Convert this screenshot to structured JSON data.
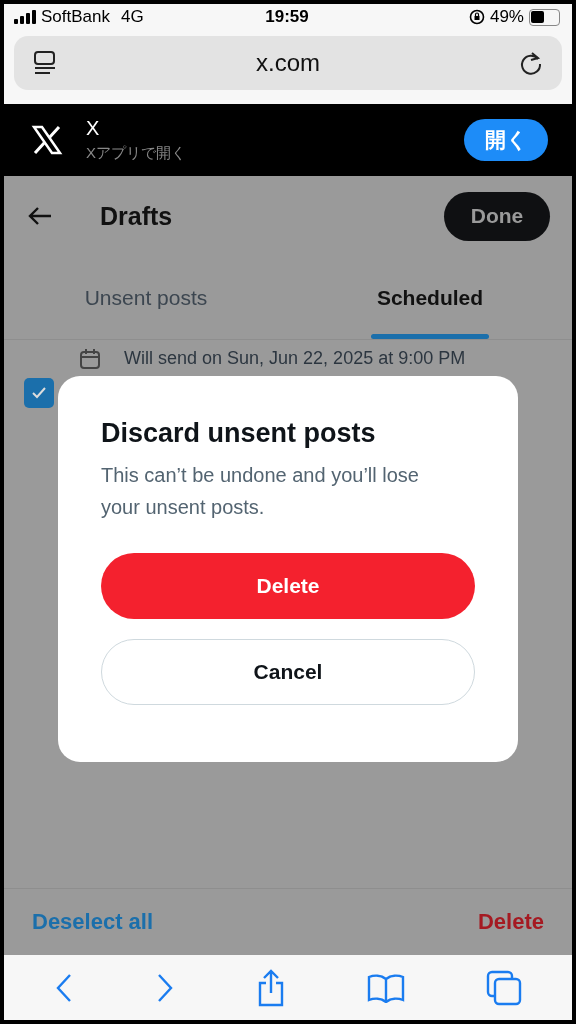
{
  "status_bar": {
    "carrier": "SoftBank",
    "network": "4G",
    "time": "19:59",
    "battery_percent": "49%",
    "battery": {
      "level": 0.49
    }
  },
  "address_bar": {
    "url": "x.com"
  },
  "app_banner": {
    "title": "X",
    "subtitle": "Xアプリで開く",
    "button": "開く"
  },
  "header": {
    "title": "Drafts",
    "done_button": "Done"
  },
  "tabs": [
    {
      "label": "Unsent posts",
      "selected": false
    },
    {
      "label": "Scheduled",
      "selected": true
    }
  ],
  "drafts": [
    {
      "text": "Will send on Sun, Jun 22, 2025 at 9:00 PM",
      "checked": true
    }
  ],
  "footer": {
    "deselect": "Deselect all",
    "delete": "Delete"
  },
  "dialog": {
    "title": "Discard unsent posts",
    "message": "This can’t be undone and you’ll lose your unsent posts.",
    "confirm": "Delete",
    "cancel": "Cancel"
  }
}
